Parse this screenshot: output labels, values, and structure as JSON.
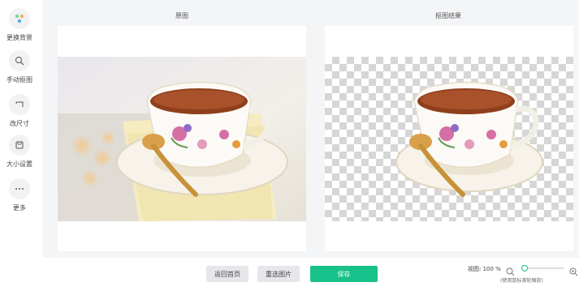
{
  "sidebar": {
    "items": [
      {
        "label": "更换背景",
        "icon": "paint-bucket-icon"
      },
      {
        "label": "手动抠图",
        "icon": "brush-icon"
      },
      {
        "label": "改尺寸",
        "icon": "resize-icon"
      },
      {
        "label": "大小设置",
        "icon": "save-disk-icon"
      },
      {
        "label": "更多",
        "icon": "more-dots-icon"
      }
    ]
  },
  "panels": {
    "original_title": "原图",
    "result_title": "抠图结果"
  },
  "actions": {
    "back_home": "返回首页",
    "reselect": "重选图片",
    "save": "保存"
  },
  "zoom": {
    "label": "视图: 100 %",
    "value": 0.05,
    "hint": "(使用鼠标滚轮缩放)"
  },
  "colors": {
    "accent": "#18c189",
    "workspace_bg": "#f4f5f7"
  }
}
